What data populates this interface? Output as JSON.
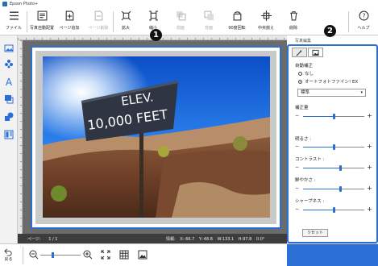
{
  "window": {
    "title": "Epson Photo+"
  },
  "toolbar": {
    "items": [
      {
        "label": "ファイル",
        "icon": "hamburger-menu-icon",
        "enabled": true
      },
      {
        "label": "写真自動配置",
        "icon": "auto-layout-icon",
        "enabled": true
      },
      {
        "label": "ページ追加",
        "icon": "add-page-icon",
        "enabled": true
      },
      {
        "label": "ページ削除",
        "icon": "delete-page-icon",
        "enabled": false
      },
      {
        "label": "拡大",
        "icon": "expand-icon",
        "enabled": true
      },
      {
        "label": "縮小",
        "icon": "shrink-icon",
        "enabled": true
      },
      {
        "label": "前面",
        "icon": "bring-front-icon",
        "enabled": false
      },
      {
        "label": "背面",
        "icon": "send-back-icon",
        "enabled": false
      },
      {
        "label": "90度回転",
        "icon": "rotate-icon",
        "enabled": true
      },
      {
        "label": "中央揃え",
        "icon": "center-align-icon",
        "enabled": true
      },
      {
        "label": "削除",
        "icon": "trash-icon",
        "enabled": true
      },
      {
        "label": "ヘルプ",
        "icon": "help-icon",
        "enabled": true
      }
    ]
  },
  "sidebar": {
    "items": [
      {
        "icon": "photo-icon"
      },
      {
        "icon": "stamp-icon"
      },
      {
        "icon": "text-icon"
      },
      {
        "icon": "frame-icon"
      },
      {
        "icon": "shape-icon"
      },
      {
        "icon": "layout-icon"
      }
    ]
  },
  "canvas": {
    "photo_sign_line1": "ELEV.",
    "photo_sign_line2": "10,000 FEET"
  },
  "statusbar": {
    "page_label": "ページ:",
    "page_value": "1 / 1",
    "info_label": "情報:",
    "x": "X:-66.7",
    "y": "Y:-48.8",
    "w": "W:133.1",
    "h": "H:97.8",
    "angle": "0.0°"
  },
  "panel": {
    "strip_label": "写真編集",
    "tabs": [
      {
        "icon": "magic-wand-icon",
        "active": true
      },
      {
        "icon": "image-adjust-icon",
        "active": false
      }
    ],
    "auto_correct_label": "自動補正",
    "radio_none": "なし",
    "radio_auto": "オートフォトファイン! EX",
    "radio_selected": "auto",
    "mode_select": "標準",
    "sliders": [
      {
        "label": "補正量",
        "value": 0.5
      },
      {
        "label": "明るさ :",
        "value": 0.5
      },
      {
        "label": "コントラスト :",
        "value": 0.6
      },
      {
        "label": "鮮やかさ :",
        "value": 0.6
      },
      {
        "label": "シャープネス :",
        "value": 0.5
      }
    ],
    "reset_label": "リセット"
  },
  "bottombar": {
    "back_label": "戻る",
    "zoom_level": 0.3
  },
  "callouts": {
    "one": "1",
    "two": "2"
  },
  "colors": {
    "accent": "#2b6ed6",
    "status_bg": "#3d3d3d",
    "canvas_bg": "#6b6b6b"
  }
}
